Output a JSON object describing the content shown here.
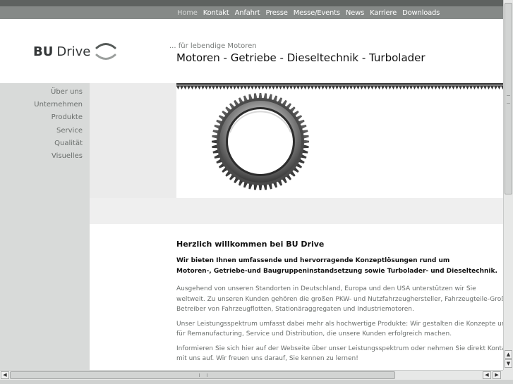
{
  "topnav": {
    "items": [
      {
        "label": "Home",
        "active": true
      },
      {
        "label": "Kontakt"
      },
      {
        "label": "Anfahrt"
      },
      {
        "label": "Presse"
      },
      {
        "label": "Messe/Events"
      },
      {
        "label": "News"
      },
      {
        "label": "Karriere"
      },
      {
        "label": "Downloads"
      }
    ]
  },
  "header": {
    "logo_bold": "BU",
    "logo_light": "Drive",
    "tagline": "... für lebendige Motoren",
    "headline": "Motoren - Getriebe - Dieseltechnik - Turbolader"
  },
  "sidebar": {
    "items": [
      {
        "label": "Über uns"
      },
      {
        "label": "Unternehmen"
      },
      {
        "label": "Produkte"
      },
      {
        "label": "Service"
      },
      {
        "label": "Qualität"
      },
      {
        "label": "Visuelles"
      }
    ]
  },
  "hero": {
    "icon": "gear-image"
  },
  "content": {
    "title": "Herzlich willkommen bei BU Drive",
    "lead_line1": "Wir bieten Ihnen umfassende und hervorragende Konzeptlösungen rund um",
    "lead_line2": "Motoren-, Getriebe-und Baugruppeninstandsetzung sowie Turbolader- und Dieseltechnik.",
    "p1_line1": "Ausgehend von unseren Standorten in Deutschland, Europa und den USA unterstützen wir Sie",
    "p1_line2": "weltweit. Zu unseren Kunden gehören die großen PKW- und Nutzfahrzeughersteller, Fahrzeugteile-Großhändler,",
    "p1_line3": "Betreiber von Fahrzeugflotten, Stationäraggregaten und Industriemotoren.",
    "p2_line1": "Unser Leistungsspektrum umfasst dabei mehr als hochwertige Produkte: Wir gestalten die Konzepte und Prozesse",
    "p2_line2": "für Remanufacturing, Service und Distribution, die unsere Kunden erfolgreich machen.",
    "p3_line1": "Informieren Sie sich hier auf der Webseite über unser Leistungsspektrum oder nehmen Sie direkt Kontakt",
    "p3_line2": "mit uns auf. Wir freuen uns darauf, Sie kennen zu lernen!"
  },
  "colors": {
    "nav_bg": "#858987",
    "sidebar_bg": "#d8dad9",
    "text_dark": "#111111",
    "text_gray": "#6a6e6c"
  }
}
